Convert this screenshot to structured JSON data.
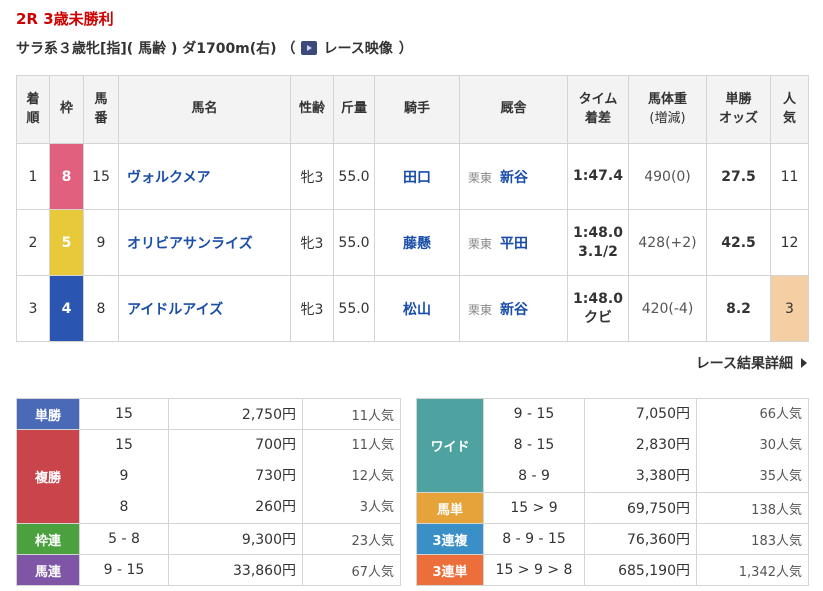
{
  "race": {
    "title": "2R 3歳未勝利",
    "conditions": "サラ系３歳牝[指]( 馬齢 ) ダ1700m(右) （",
    "video_label": "レース映像",
    "close_paren": "）"
  },
  "table": {
    "headers": [
      {
        "l1": "着",
        "l2": "順"
      },
      {
        "l1": "枠",
        "l2": ""
      },
      {
        "l1": "馬",
        "l2": "番"
      },
      {
        "l1": "馬名",
        "l2": ""
      },
      {
        "l1": "性齢",
        "l2": ""
      },
      {
        "l1": "斤量",
        "l2": ""
      },
      {
        "l1": "騎手",
        "l2": ""
      },
      {
        "l1": "厩舎",
        "l2": ""
      },
      {
        "l1": "タイム",
        "l2": "着差"
      },
      {
        "l1": "馬体重",
        "l2": "(増減)"
      },
      {
        "l1": "単勝",
        "l2": "オッズ"
      },
      {
        "l1": "人",
        "l2": "気"
      }
    ],
    "rows": [
      {
        "rank": "1",
        "waku": "8",
        "waku_color": "#e0607e",
        "num": "15",
        "horse": "ヴォルクメア",
        "sexage": "牝3",
        "kinryo": "55.0",
        "jockey": "田口",
        "area": "栗東",
        "trainer": "新谷",
        "time": "1:47.4",
        "margin": "",
        "weight": "490(0)",
        "odds": "27.5",
        "pop": "11"
      },
      {
        "rank": "2",
        "waku": "5",
        "waku_color": "#e8c93a",
        "num": "9",
        "horse": "オリビアサンライズ",
        "sexage": "牝3",
        "kinryo": "55.0",
        "jockey": "藤懸",
        "area": "栗東",
        "trainer": "平田",
        "time": "1:48.0",
        "margin": "3.1/2",
        "weight": "428(+2)",
        "odds": "42.5",
        "pop": "12"
      },
      {
        "rank": "3",
        "waku": "4",
        "waku_color": "#2a55b0",
        "num": "8",
        "horse": "アイドルアイズ",
        "sexage": "牝3",
        "kinryo": "55.0",
        "jockey": "松山",
        "area": "栗東",
        "trainer": "新谷",
        "time": "1:48.0",
        "margin": "クビ",
        "weight": "420(-4)",
        "odds": "8.2",
        "pop": "3"
      }
    ]
  },
  "detail_link": "レース結果詳細",
  "payouts_left": [
    {
      "type": "単勝",
      "color": "#4a6ab8",
      "entries": [
        {
          "combo": "15",
          "amount": "2,750円",
          "pop": "11人気"
        }
      ]
    },
    {
      "type": "複勝",
      "color": "#c9444b",
      "entries": [
        {
          "combo": "15",
          "amount": "700円",
          "pop": "11人気"
        },
        {
          "combo": "9",
          "amount": "730円",
          "pop": "12人気"
        },
        {
          "combo": "8",
          "amount": "260円",
          "pop": "3人気"
        }
      ]
    },
    {
      "type": "枠連",
      "color": "#4ba13e",
      "entries": [
        {
          "combo": "5 - 8",
          "amount": "9,300円",
          "pop": "23人気"
        }
      ]
    },
    {
      "type": "馬連",
      "color": "#7f55a5",
      "entries": [
        {
          "combo": "9 - 15",
          "amount": "33,860円",
          "pop": "67人気"
        }
      ]
    }
  ],
  "payouts_right": [
    {
      "type": "ワイド",
      "color": "#4ea2a0",
      "entries": [
        {
          "combo": "9 - 15",
          "amount": "7,050円",
          "pop": "66人気"
        },
        {
          "combo": "8 - 15",
          "amount": "2,830円",
          "pop": "30人気"
        },
        {
          "combo": "8 - 9",
          "amount": "3,380円",
          "pop": "35人気"
        }
      ]
    },
    {
      "type": "馬単",
      "color": "#e6a33a",
      "entries": [
        {
          "combo": "15 > 9",
          "amount": "69,750円",
          "pop": "138人気"
        }
      ]
    },
    {
      "type": "3連複",
      "color": "#3a8fc6",
      "entries": [
        {
          "combo": "8 - 9 - 15",
          "amount": "76,360円",
          "pop": "183人気"
        }
      ]
    },
    {
      "type": "3連単",
      "color": "#ec6e3a",
      "entries": [
        {
          "combo": "15 > 9 > 8",
          "amount": "685,190円",
          "pop": "1,342人気"
        }
      ]
    }
  ]
}
